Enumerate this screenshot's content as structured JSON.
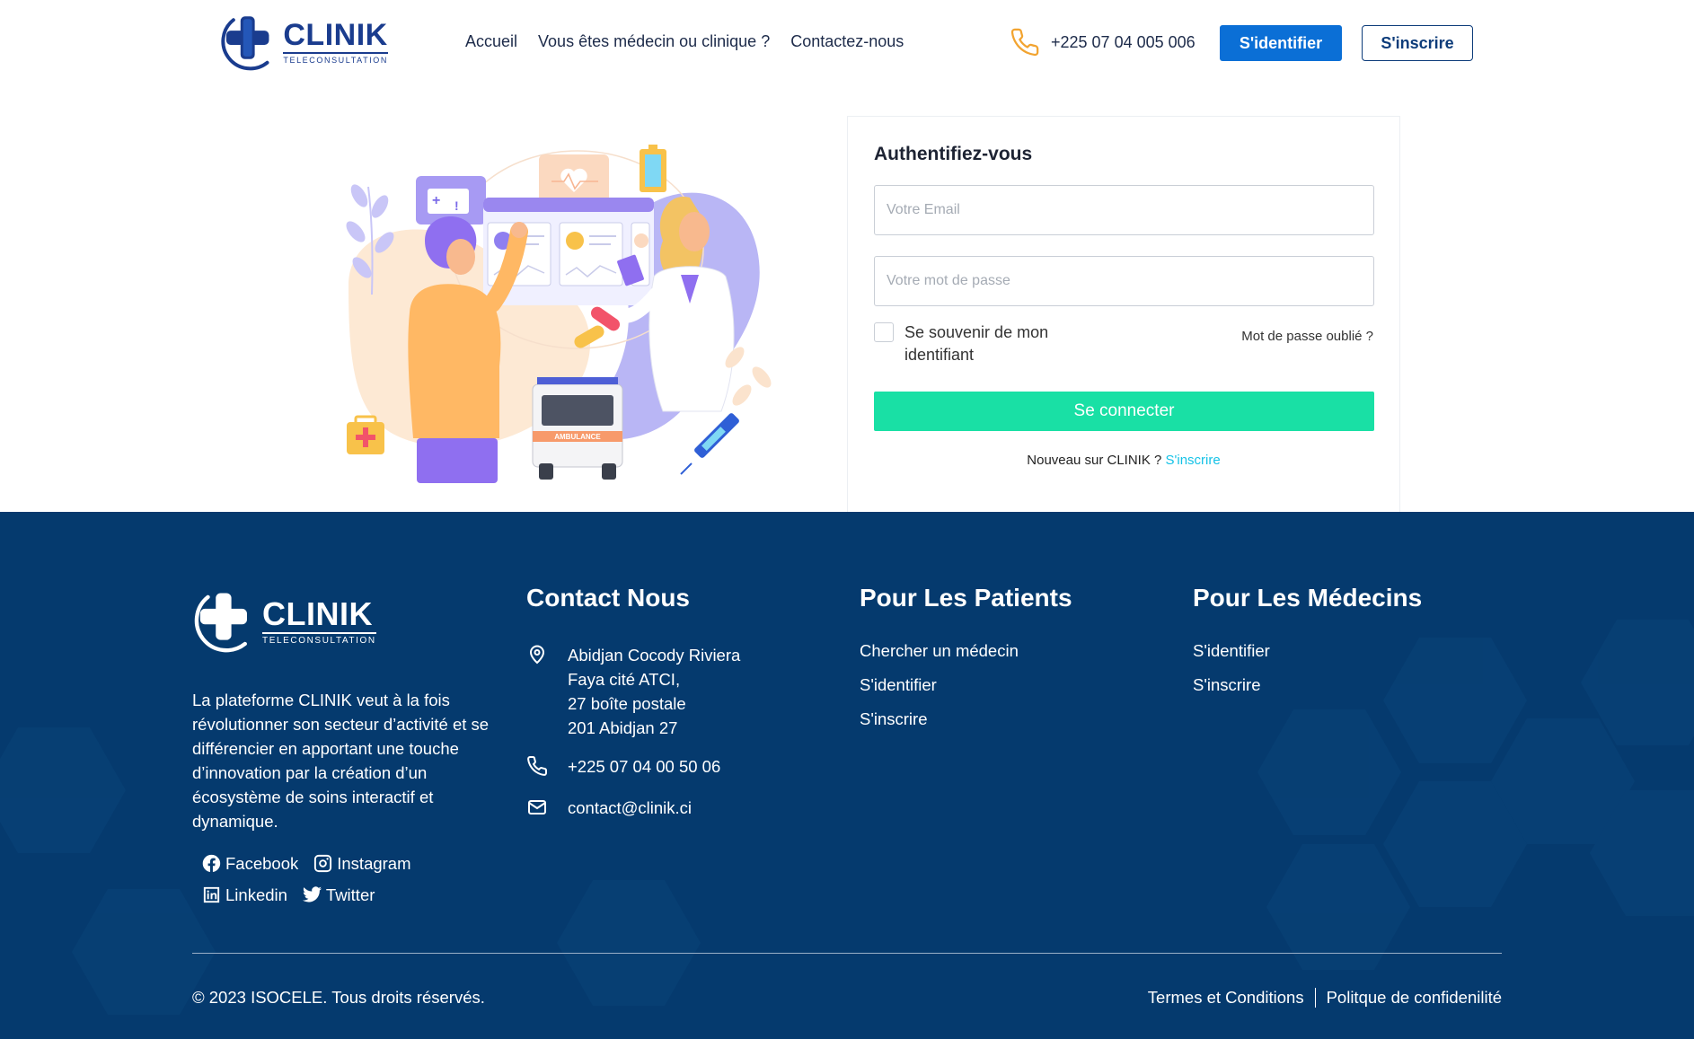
{
  "header": {
    "logo": {
      "title": "CLINIK",
      "subtitle": "TELECONSULTATION"
    },
    "nav": [
      {
        "label": "Accueil"
      },
      {
        "label": "Vous êtes médecin ou clinique ?"
      },
      {
        "label": "Contactez-nous"
      }
    ],
    "phone": "+225 07 04 005 006",
    "login_label": "S'identifier",
    "signup_label": "S'inscrire"
  },
  "auth": {
    "title": "Authentifiez-vous",
    "email_placeholder": "Votre Email",
    "password_placeholder": "Votre mot de passe",
    "remember_label": "Se souvenir de mon identifiant",
    "forgot_label": "Mot de passe oublié ?",
    "submit_label": "Se connecter",
    "new_user_text": "Nouveau sur CLINIK ?",
    "new_user_link": "S'inscrire"
  },
  "illustration": {
    "ambulance_label": "AMBULANCE"
  },
  "footer": {
    "logo": {
      "title": "CLINIK",
      "subtitle": "TELECONSULTATION"
    },
    "about": "La plateforme CLINIK veut à la fois révolutionner son secteur d’activité et se différencier en apportant une touche d’innovation par la création d’un écosystème de soins interactif et dynamique.",
    "socials": [
      {
        "label": "Facebook",
        "icon": "facebook-icon"
      },
      {
        "label": "Instagram",
        "icon": "instagram-icon"
      },
      {
        "label": "Linkedin",
        "icon": "linkedin-icon"
      },
      {
        "label": "Twitter",
        "icon": "twitter-icon"
      }
    ],
    "contact": {
      "title": "Contact Nous",
      "address": [
        "Abidjan Cocody Riviera",
        "Faya cité ATCI,",
        "27 boîte postale",
        "201 Abidjan 27"
      ],
      "phone": "+225 07 04 00 50 06",
      "email": "contact@clinik.ci"
    },
    "patients": {
      "title": "Pour Les Patients",
      "links": [
        "Chercher un médecin",
        "S'identifier",
        "S'inscrire"
      ]
    },
    "doctors": {
      "title": "Pour Les Médecins",
      "links": [
        "S'identifier",
        "S'inscrire"
      ]
    },
    "copyright": "© 2023 ISOCELE. Tous droits réservés.",
    "terms": "Termes et Conditions",
    "privacy": "Politque de confidenilité"
  },
  "colors": {
    "brand_blue": "#1a3c8e",
    "primary_button": "#0b6fd6",
    "connect_button": "#19e0a5",
    "footer_bg": "#053a6e",
    "link_cyan": "#15c2e6"
  }
}
